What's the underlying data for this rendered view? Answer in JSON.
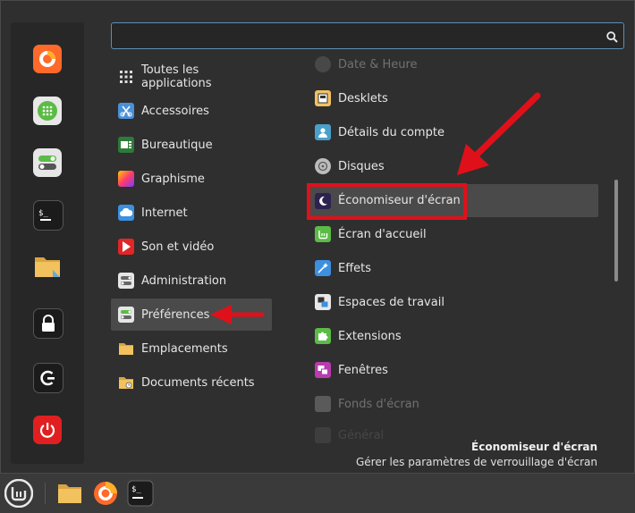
{
  "search": {
    "value": "",
    "placeholder": ""
  },
  "favorites": [
    {
      "name": "firefox-icon",
      "color": "#ff6a2a"
    },
    {
      "name": "calculator-icon",
      "color": "#5bbb46"
    },
    {
      "name": "settings-toggle-icon",
      "color": "#e0e0e0"
    },
    {
      "name": "terminal-icon",
      "color": "#1b1b1b"
    },
    {
      "name": "folder-icon",
      "color": "#f2c25f"
    },
    {
      "name": "lock-icon",
      "color": "#1b1b1b"
    },
    {
      "name": "logout-icon",
      "color": "#1b1b1b"
    },
    {
      "name": "power-icon",
      "color": "#e02020"
    }
  ],
  "categories": [
    {
      "label": "Toutes les applications",
      "icon": "grid-icon"
    },
    {
      "label": "Accessoires",
      "icon": "scissors-icon"
    },
    {
      "label": "Bureautique",
      "icon": "office-icon"
    },
    {
      "label": "Graphisme",
      "icon": "graphics-icon"
    },
    {
      "label": "Internet",
      "icon": "cloud-icon"
    },
    {
      "label": "Son et vidéo",
      "icon": "play-icon"
    },
    {
      "label": "Administration",
      "icon": "admin-toggle-icon"
    },
    {
      "label": "Préférences",
      "icon": "preferences-toggle-icon",
      "selected": true
    },
    {
      "label": "Emplacements",
      "icon": "folder-icon"
    },
    {
      "label": "Documents récents",
      "icon": "recent-folder-icon"
    }
  ],
  "apps": [
    {
      "label": "Date & Heure",
      "icon": "clock-icon",
      "state": "faded"
    },
    {
      "label": "Desklets",
      "icon": "desklets-icon"
    },
    {
      "label": "Détails du compte",
      "icon": "account-icon"
    },
    {
      "label": "Disques",
      "icon": "disk-icon"
    },
    {
      "label": "Économiseur d'écran",
      "icon": "moon-icon",
      "selected": true
    },
    {
      "label": "Écran d'accueil",
      "icon": "mint-icon"
    },
    {
      "label": "Effets",
      "icon": "effects-icon"
    },
    {
      "label": "Espaces de travail",
      "icon": "workspaces-icon"
    },
    {
      "label": "Extensions",
      "icon": "puzzle-icon"
    },
    {
      "label": "Fenêtres",
      "icon": "windows-icon"
    },
    {
      "label": "Fonds d'écran",
      "icon": "wallpaper-icon",
      "state": "faded"
    },
    {
      "label": "Général",
      "icon": "general-icon",
      "state": "veryfaded"
    }
  ],
  "description": {
    "title": "Économiseur d'écran",
    "text": "Gérer les paramètres de verrouillage d'écran"
  },
  "annotation_color": "#e0101a",
  "panel": [
    {
      "name": "mint-menu-icon"
    },
    {
      "name": "files-icon"
    },
    {
      "name": "firefox-icon"
    },
    {
      "name": "terminal-icon"
    }
  ]
}
